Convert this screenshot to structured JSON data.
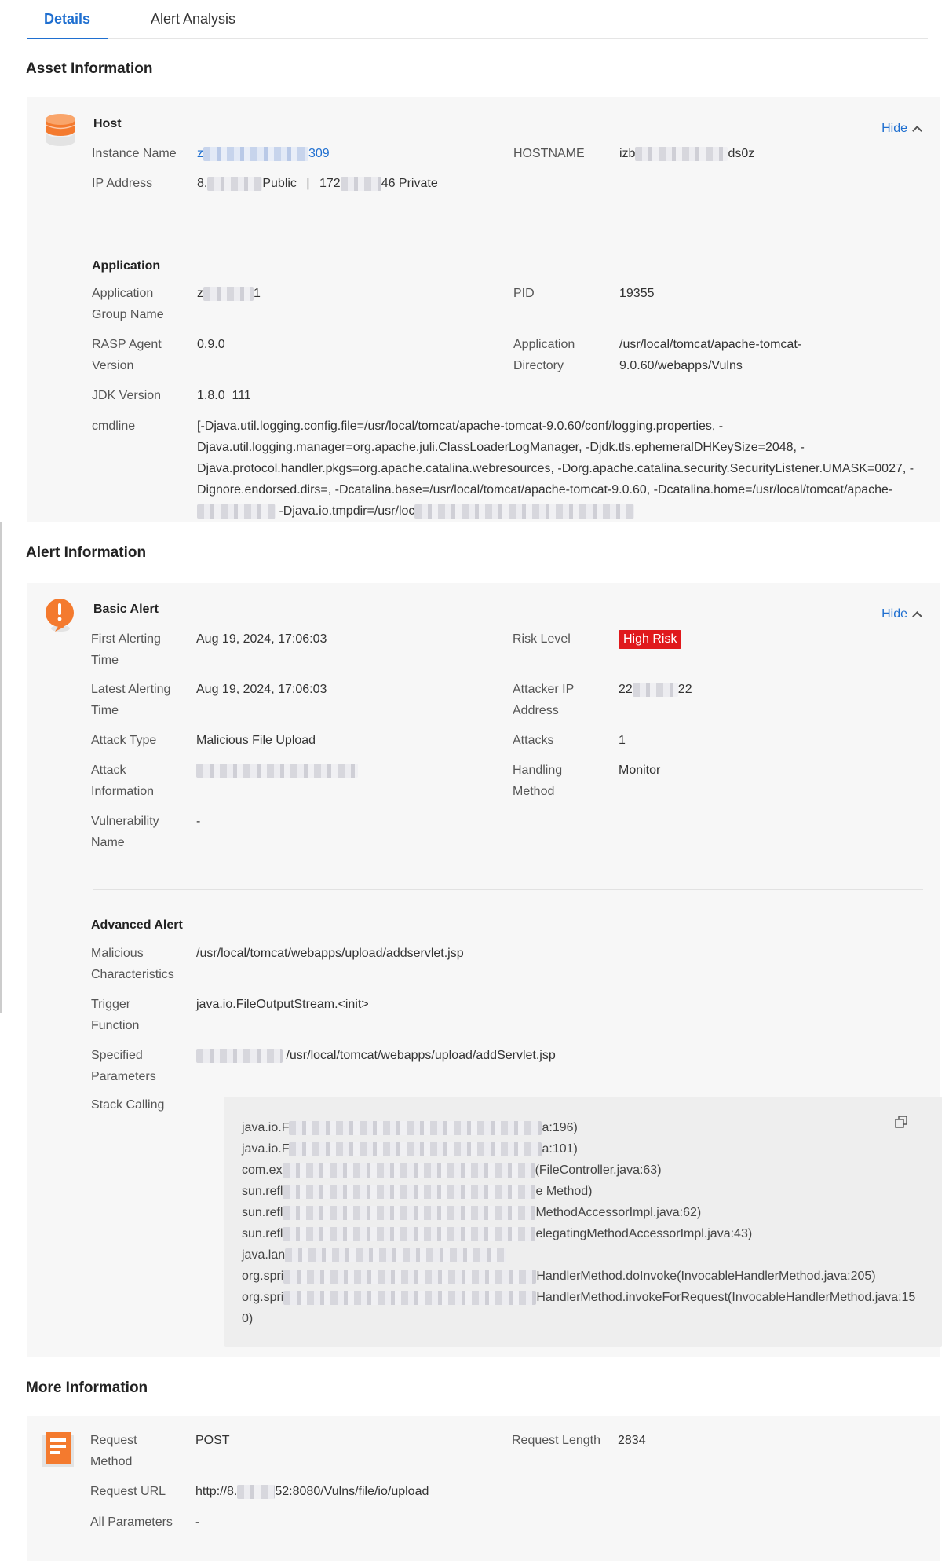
{
  "tabs": [
    "Details",
    "Alert Analysis"
  ],
  "sections": {
    "asset": "Asset Information",
    "alert": "Alert Information",
    "more": "More Information"
  },
  "hide_label": "Hide",
  "host": {
    "title": "Host",
    "instance_name_label": "Instance Name",
    "instance_name_prefix": "z",
    "instance_name_suffix": "309",
    "hostname_label": "HOSTNAME",
    "hostname_prefix": "izb",
    "hostname_suffix": "ds0z",
    "ip_label": "IP Address",
    "ip_public_prefix": "8.",
    "ip_public_suffix": "Public",
    "ip_sep": "|",
    "ip_private_prefix": "172",
    "ip_private_suffix": "46 Private"
  },
  "application": {
    "title": "Application",
    "group_label_1": "Application",
    "group_label_2": "Group Name",
    "group_prefix": "z",
    "group_suffix": "1",
    "pid_label": "PID",
    "pid": "19355",
    "rasp_label_1": "RASP Agent",
    "rasp_label_2": "Version",
    "rasp": "0.9.0",
    "dir_label_1": "Application",
    "dir_label_2": "Directory",
    "dir_1": "/usr/local/tomcat/apache-tomcat-",
    "dir_2": "9.0.60/webapps/Vulns",
    "jdk_label": "JDK Version",
    "jdk": "1.8.0_111",
    "cmd_label": "cmdline",
    "cmd_1": "[-Djava.util.logging.config.file=/usr/local/tomcat/apache-tomcat-9.0.60/conf/logging.properties, -",
    "cmd_2": "Djava.util.logging.manager=org.apache.juli.ClassLoaderLogManager, -Djdk.tls.ephemeralDHKeySize=2048, -",
    "cmd_3": "Djava.protocol.handler.pkgs=org.apache.catalina.webresources, -Dorg.apache.catalina.security.SecurityListener.UMASK=0027, -",
    "cmd_4": "Dignore.endorsed.dirs=, -Dcatalina.base=/usr/local/tomcat/apache-tomcat-9.0.60, -Dcatalina.home=/usr/local/tomcat/apache-",
    "cmd_5": "-Djava.io.tmpdir=/usr/loc"
  },
  "basic_alert": {
    "title": "Basic Alert",
    "first_label_1": "First Alerting",
    "first_label_2": "Time",
    "first": "Aug 19, 2024, 17:06:03",
    "risk_label": "Risk Level",
    "risk": "High Risk",
    "latest_label_1": "Latest Alerting",
    "latest_label_2": "Time",
    "latest": "Aug 19, 2024, 17:06:03",
    "attacker_label_1": "Attacker IP",
    "attacker_label_2": "Address",
    "attacker_prefix": "22",
    "attacker_suffix": "22",
    "type_label": "Attack Type",
    "type": "Malicious File Upload",
    "attacks_label": "Attacks",
    "attacks": "1",
    "info_label_1": "Attack",
    "info_label_2": "Information",
    "handling_label_1": "Handling",
    "handling_label_2": "Method",
    "handling": "Monitor",
    "vuln_label_1": "Vulnerability",
    "vuln_label_2": "Name",
    "vuln": "-"
  },
  "advanced_alert": {
    "title": "Advanced Alert",
    "mal_label_1": "Malicious",
    "mal_label_2": "Characteristics",
    "mal": "/usr/local/tomcat/webapps/upload/addservlet.jsp",
    "trigger_label_1": "Trigger",
    "trigger_label_2": "Function",
    "trigger": "java.io.FileOutputStream.<init>",
    "params_label_1": "Specified",
    "params_label_2": "Parameters",
    "params": "/usr/local/tomcat/webapps/upload/addServlet.jsp",
    "stack_label": "Stack Calling",
    "stack": [
      {
        "pre": "java.io.F",
        "post": "a:196)"
      },
      {
        "pre": "java.io.F",
        "post": "a:101)"
      },
      {
        "pre": "com.ex",
        "post": "(FileController.java:63)"
      },
      {
        "pre": "sun.refl",
        "post": "e Method)"
      },
      {
        "pre": "sun.refl",
        "post": "MethodAccessorImpl.java:62)"
      },
      {
        "pre": "sun.refl",
        "post": "elegatingMethodAccessorImpl.java:43)"
      },
      {
        "pre": "java.lan",
        "post": ""
      },
      {
        "pre": "org.spri",
        "post": "HandlerMethod.doInvoke(InvocableHandlerMethod.java:205)"
      },
      {
        "pre": "org.spri",
        "post": "HandlerMethod.invokeForRequest(InvocableHandlerMethod.java:15"
      }
    ],
    "stack_tail": "0)"
  },
  "more": {
    "req_method_label_1": "Request",
    "req_method_label_2": "Method",
    "req_method": "POST",
    "req_len_label": "Request Length",
    "req_len": "2834",
    "url_label": "Request URL",
    "url_prefix": "http://8.",
    "url_suffix": "52:8080/Vulns/file/io/upload",
    "all_params_label": "All Parameters",
    "all_params": "-"
  },
  "colors": {
    "accent": "#1f6fd0",
    "risk_high": "#e0191c",
    "card_bg": "#f7f7f7",
    "icon_orange": "#f47a2e"
  },
  "icons": [
    "database-icon",
    "alert-exclamation-icon",
    "document-icon",
    "chevron-up-icon",
    "copy-icon"
  ]
}
